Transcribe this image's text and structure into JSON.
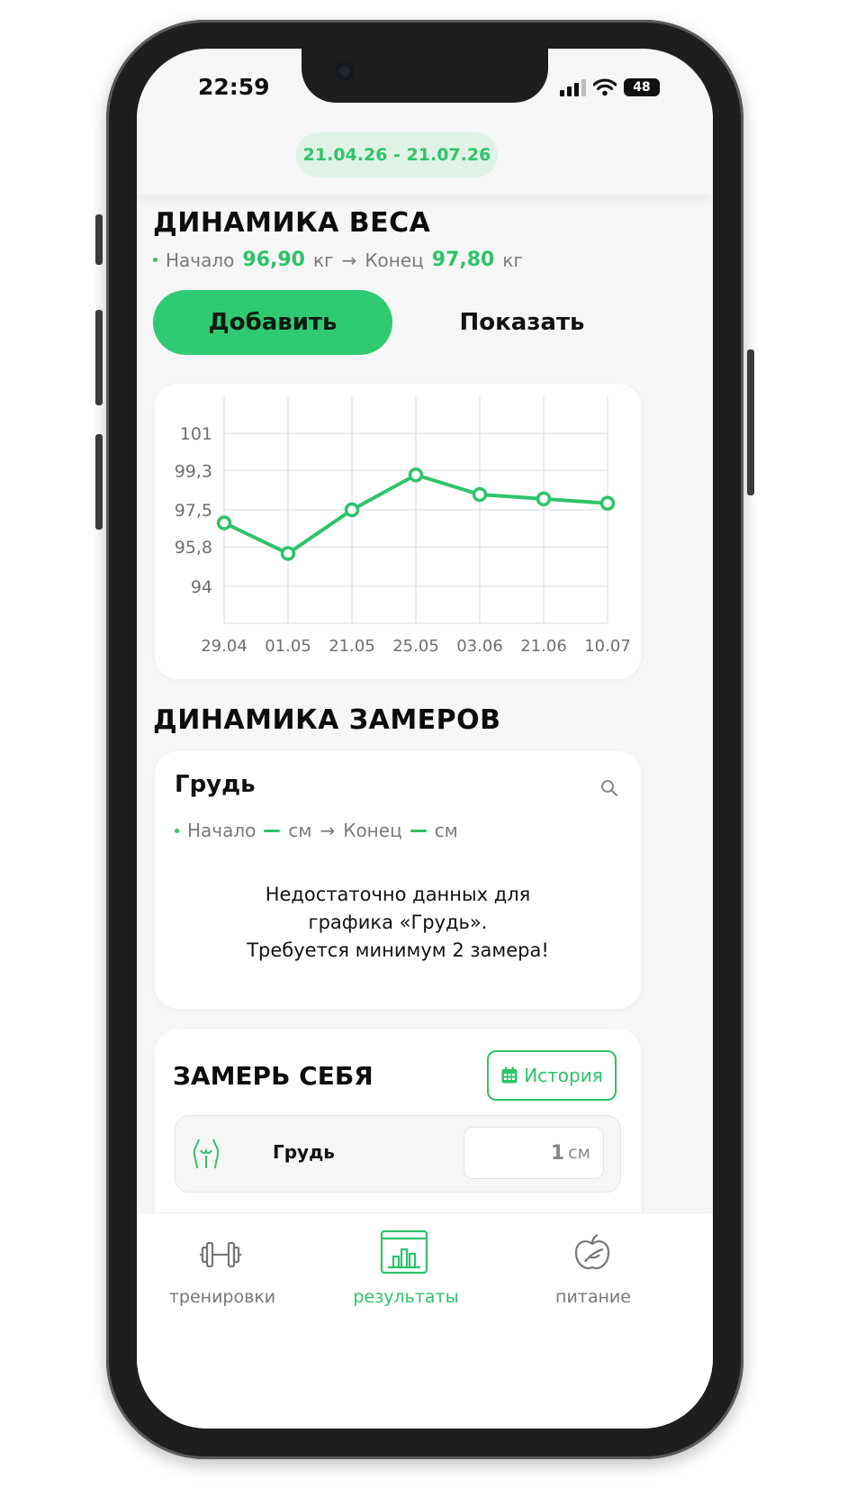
{
  "status": {
    "time": "22:59",
    "battery": "48"
  },
  "period": "21.04.26 - 21.07.26",
  "weight": {
    "title": "ДИНАМИКА ВЕСА",
    "start_label": "Начало",
    "start_value": "96,90",
    "unit": "кг",
    "arrow": "→",
    "end_label": "Конец",
    "end_value": "97,80",
    "add_button": "Добавить",
    "show_button": "Показать"
  },
  "chart_data": {
    "type": "line",
    "x": [
      "29.04",
      "01.05",
      "21.05",
      "25.05",
      "03.06",
      "21.06",
      "10.07"
    ],
    "series": [
      {
        "values": [
          96.9,
          95.5,
          97.5,
          99.1,
          98.2,
          98.0,
          97.8
        ]
      }
    ],
    "y_ticks": [
      "101",
      "99,3",
      "97,5",
      "95,8",
      "94"
    ],
    "ylim": [
      92.3,
      102.7
    ],
    "grid": true,
    "color": "#2fc36a"
  },
  "measurements": {
    "title": "ДИНАМИКА ЗАМЕРОВ",
    "card_title": "Грудь",
    "start_label": "Начало",
    "unit": "см",
    "arrow": "→",
    "end_label": "Конец",
    "message_line1": "Недостаточно данных для",
    "message_line2": "графика «Грудь».",
    "message_line3": "Требуется минимум 2 замера!"
  },
  "self_measure": {
    "title": "ЗАМЕРЬ СЕБЯ",
    "history_button": "История",
    "row_label": "Грудь",
    "row_value": "1",
    "row_unit": "см"
  },
  "tabs": [
    {
      "label": "тренировки",
      "icon": "dumbbell-icon"
    },
    {
      "label": "результаты",
      "icon": "results-chart-icon"
    },
    {
      "label": "питание",
      "icon": "apple-icon"
    }
  ],
  "colors": {
    "accent": "#2fc36a",
    "button": "#2fcb72"
  }
}
